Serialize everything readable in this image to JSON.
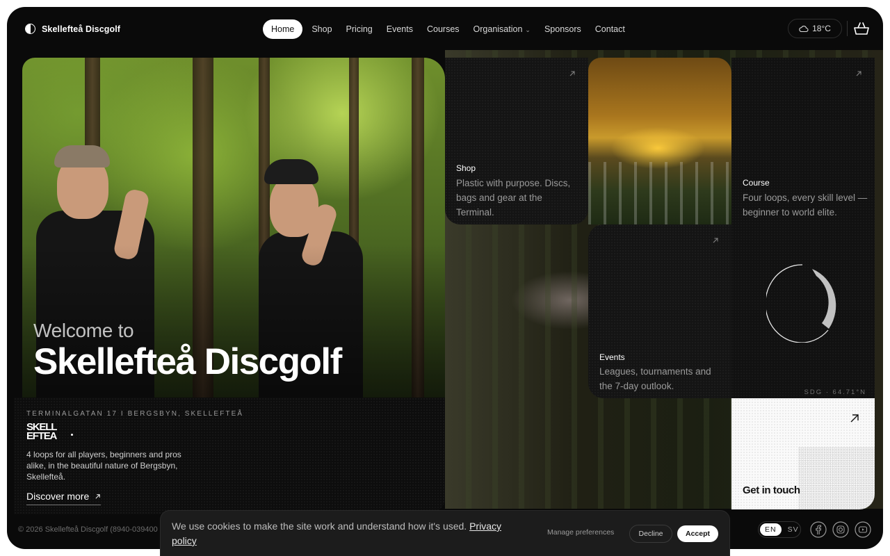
{
  "header": {
    "brand": "Skellefteå Discgolf",
    "nav": [
      {
        "label": "Home",
        "active": true
      },
      {
        "label": "Shop"
      },
      {
        "label": "Pricing"
      },
      {
        "label": "Events"
      },
      {
        "label": "Courses"
      },
      {
        "label": "Organisation",
        "has_dropdown": true
      },
      {
        "label": "Sponsors"
      },
      {
        "label": "Contact"
      }
    ],
    "weather": "18°C",
    "icons": {
      "weather": "cloud-icon",
      "cart": "basket-icon",
      "logo": "half-circle-logo-icon"
    }
  },
  "hero": {
    "welcome": "Welcome to",
    "title": "Skellefteå Discgolf"
  },
  "info": {
    "address": "TERMINALGATAN 17 I BERGSBYN, SKELLEFTEÅ",
    "wordmark_line1": "SKELL",
    "wordmark_line2": "EFTEA",
    "description": "4 loops for all players, beginners and pros alike, in the beautiful nature of Bergsbyn, Skellefteå.",
    "discover": "Discover more"
  },
  "tiles": {
    "shop": {
      "label": "Shop",
      "description": "Plastic with purpose. Discs, bags and gear at the Terminal."
    },
    "course": {
      "label": "Course",
      "description": "Four loops, every skill level — beginner to world elite.",
      "coords": "SDG · 64.71°N"
    },
    "events": {
      "label": "Events",
      "description": "Leagues, tournaments and the 7-day outlook."
    },
    "contact": {
      "label": "Get in touch"
    }
  },
  "footer": {
    "copyright": "© 2026 Skellefteå Discgolf (8940-039400",
    "languages": [
      {
        "code": "EN",
        "active": true
      },
      {
        "code": "SV"
      }
    ],
    "social": [
      "facebook-icon",
      "instagram-icon",
      "youtube-icon"
    ]
  },
  "cookie": {
    "text": "We use cookies to make the site work and understand how it's used.",
    "policy_link": "Privacy policy",
    "manage": "Manage preferences",
    "decline": "Decline",
    "accept": "Accept"
  },
  "colors": {
    "background": "#0a0a0a",
    "tile": "#141414",
    "accent": "#ffffff",
    "muted_text": "#9a9a9a"
  }
}
